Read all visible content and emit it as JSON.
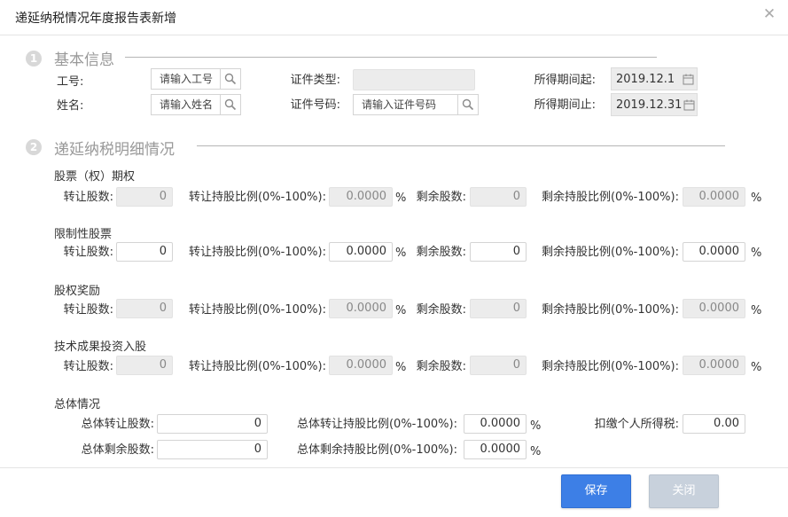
{
  "dialog": {
    "title": "递延纳税情况年度报告表新增",
    "close_icon": "close-icon"
  },
  "section1": {
    "number": "1",
    "title": "基本信息",
    "emp_no_label": "工号:",
    "emp_no_placeholder": "请输入工号",
    "cert_type_label": "证件类型:",
    "cert_type_value": "",
    "period_start_label": "所得期间起:",
    "period_start_value": "2019.12.1",
    "name_label": "姓名:",
    "name_placeholder": "请输入姓名",
    "cert_no_label": "证件号码:",
    "cert_no_placeholder": "请输入证件号码",
    "period_end_label": "所得期间止:",
    "period_end_value": "2019.12.31"
  },
  "section2": {
    "number": "2",
    "title": "递延纳税明细情况"
  },
  "labels": {
    "shares": "转让股数:",
    "ratio": "转让持股比例(0%-100%):",
    "remain_shares": "剩余股数:",
    "remain_ratio": "剩余持股比例(0%-100%):",
    "percent": "%"
  },
  "groups": [
    {
      "title": "股票（权）期权",
      "shares": "0",
      "ratio": "0.0000",
      "remain_shares": "0",
      "remain_ratio": "0.0000",
      "enabled": false
    },
    {
      "title": "限制性股票",
      "shares": "0",
      "ratio": "0.0000",
      "remain_shares": "0",
      "remain_ratio": "0.0000",
      "enabled": true
    },
    {
      "title": "股权奖励",
      "shares": "0",
      "ratio": "0.0000",
      "remain_shares": "0",
      "remain_ratio": "0.0000",
      "enabled": false
    },
    {
      "title": "技术成果投资入股",
      "shares": "0",
      "ratio": "0.0000",
      "remain_shares": "0",
      "remain_ratio": "0.0000",
      "enabled": false
    }
  ],
  "overall": {
    "title": "总体情况",
    "total_transfer_label": "总体转让股数:",
    "total_transfer_value": "0",
    "total_transfer_ratio_label": "总体转让持股比例(0%-100%):",
    "total_transfer_ratio_value": "0.0000",
    "tax_label": "扣缴个人所得税:",
    "tax_value": "0.00",
    "total_remain_label": "总体剩余股数:",
    "total_remain_value": "0",
    "total_remain_ratio_label": "总体剩余持股比例(0%-100%):",
    "total_remain_ratio_value": "0.0000",
    "percent": "%"
  },
  "footer": {
    "save_label": "保存",
    "close_label": "关闭"
  },
  "colors": {
    "accent": "#3d7fe6",
    "disabled_button": "#c8d1dc",
    "disabled_field": "#ececec"
  }
}
